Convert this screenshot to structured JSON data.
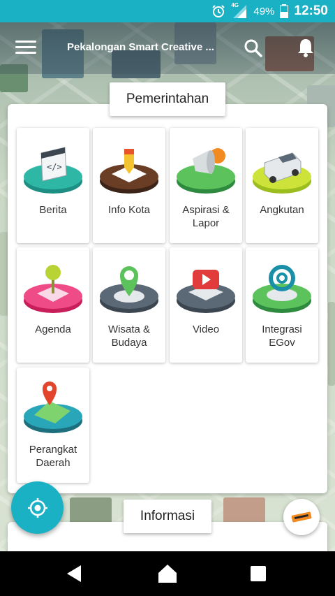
{
  "status_bar": {
    "network": "4G",
    "battery": "49%",
    "time": "12:50"
  },
  "header": {
    "title": "Pekalongan Smart Creative ..."
  },
  "sections": {
    "pemerintahan": "Pemerintahan",
    "informasi": "Informasi"
  },
  "tiles": [
    {
      "label": "Berita",
      "icon": "news-icon"
    },
    {
      "label": "Info Kota",
      "icon": "city-info-icon"
    },
    {
      "label": "Aspirasi &\nLapor",
      "icon": "report-icon"
    },
    {
      "label": "Angkutan",
      "icon": "transport-icon"
    },
    {
      "label": "Agenda",
      "icon": "agenda-icon"
    },
    {
      "label": "Wisata &\nBudaya",
      "icon": "tourism-icon"
    },
    {
      "label": "Video",
      "icon": "video-icon"
    },
    {
      "label": "Integrasi\nEGov",
      "icon": "egov-icon"
    },
    {
      "label": "Perangkat\nDaerah",
      "icon": "regional-device-icon"
    }
  ],
  "colors": {
    "accent": "#1ab1c5",
    "brand_orange": "#f28a22"
  }
}
